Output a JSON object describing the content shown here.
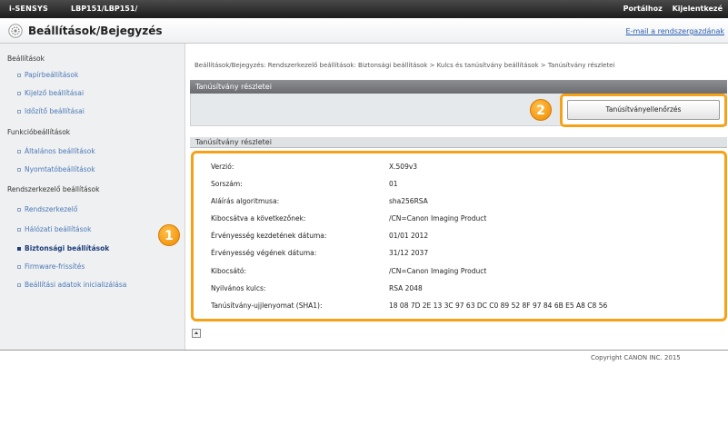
{
  "topbar": {
    "brand": "i-SENSYS",
    "model": "LBP151/LBP151/",
    "links": [
      "Portálhoz",
      "Kijelentkezé"
    ]
  },
  "header": {
    "title": "Beállítások/Bejegyzés",
    "mail_link": "E-mail a rendszergazdának"
  },
  "sidebar": {
    "sections": [
      {
        "label": "Beállítások",
        "items": [
          {
            "label": "Papírbeállítások"
          },
          {
            "label": "Kijelző beállításai"
          },
          {
            "label": "Időzítő beállításai"
          }
        ]
      },
      {
        "label": "Funkcióbeállítások",
        "items": [
          {
            "label": "Általános beállítások"
          },
          {
            "label": "Nyomtatóbeállítások"
          }
        ]
      },
      {
        "label": "Rendszerkezelő beállítások",
        "items": [
          {
            "label": "Rendszerkezelő"
          },
          {
            "label": "Hálózati beállítások"
          },
          {
            "label": "Biztonsági beállítások",
            "active": true
          },
          {
            "label": "Firmware-frissítés"
          },
          {
            "label": "Beállítási adatok inicializálása"
          }
        ]
      }
    ]
  },
  "breadcrumb": "Beállítások/Bejegyzés: Rendszerkezelő beállítások: Biztonsági beállítások > Kulcs és tanúsítvány beállítások > Tanúsítvány részletei",
  "panel1": {
    "title": "Tanúsítvány részletei",
    "button_label": "Tanúsítványellenőrzés"
  },
  "panel2": {
    "title": "Tanúsítvány részletei",
    "rows": [
      {
        "label": "Verzió:",
        "value": "X.509v3"
      },
      {
        "label": "Sorszám:",
        "value": "01"
      },
      {
        "label": "Aláírás algoritmusa:",
        "value": "sha256RSA"
      },
      {
        "label": "Kibocsátva a következőnek:",
        "value": "/CN=Canon Imaging Product"
      },
      {
        "label": "Érvényesség kezdetének dátuma:",
        "value": "01/01 2012"
      },
      {
        "label": "Érvényesség végének dátuma:",
        "value": "31/12 2037"
      },
      {
        "label": "Kibocsátó:",
        "value": "/CN=Canon Imaging Product"
      },
      {
        "label": "Nyilvános kulcs:",
        "value": "RSA 2048"
      },
      {
        "label": "Tanúsítvány-ujjlenyomat (SHA1):",
        "value": "18 08 7D 2E 13 3C 97 63 DC C0 89 52 8F 97 84 6B E5 A8 C8 56"
      }
    ]
  },
  "callouts": [
    "1",
    "2"
  ],
  "footer": {
    "copyright": "Copyright CANON INC. 2015"
  },
  "colors": {
    "accent_orange": "#f5a218",
    "link_blue": "#4a78b8",
    "header_dark": "#2a2a2a"
  }
}
